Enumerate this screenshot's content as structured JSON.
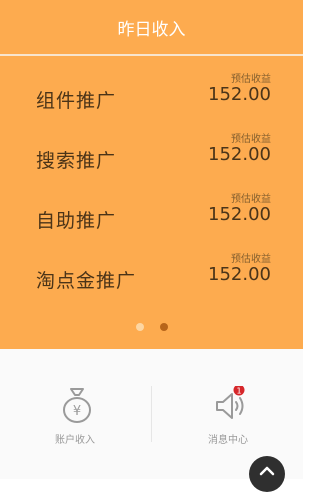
{
  "header": {
    "title": "昨日收入"
  },
  "income_rows": [
    {
      "name": "组件推广",
      "sublabel": "预估收益",
      "amount": "152.00"
    },
    {
      "name": "搜索推广",
      "sublabel": "预估收益",
      "amount": "152.00"
    },
    {
      "name": "自助推广",
      "sublabel": "预估收益",
      "amount": "152.00"
    },
    {
      "name": "淘点金推广",
      "sublabel": "预估收益",
      "amount": "152.00"
    }
  ],
  "pager": {
    "count": 2,
    "active_index": 1
  },
  "bottom_nav": {
    "account": {
      "label": "账户收入",
      "icon": "money-bag-icon"
    },
    "messages": {
      "label": "消息中心",
      "icon": "speaker-icon",
      "badge": "1"
    }
  },
  "colors": {
    "accent": "#fdab4f",
    "text_dark": "#4b3418",
    "badge": "#d6272a"
  }
}
